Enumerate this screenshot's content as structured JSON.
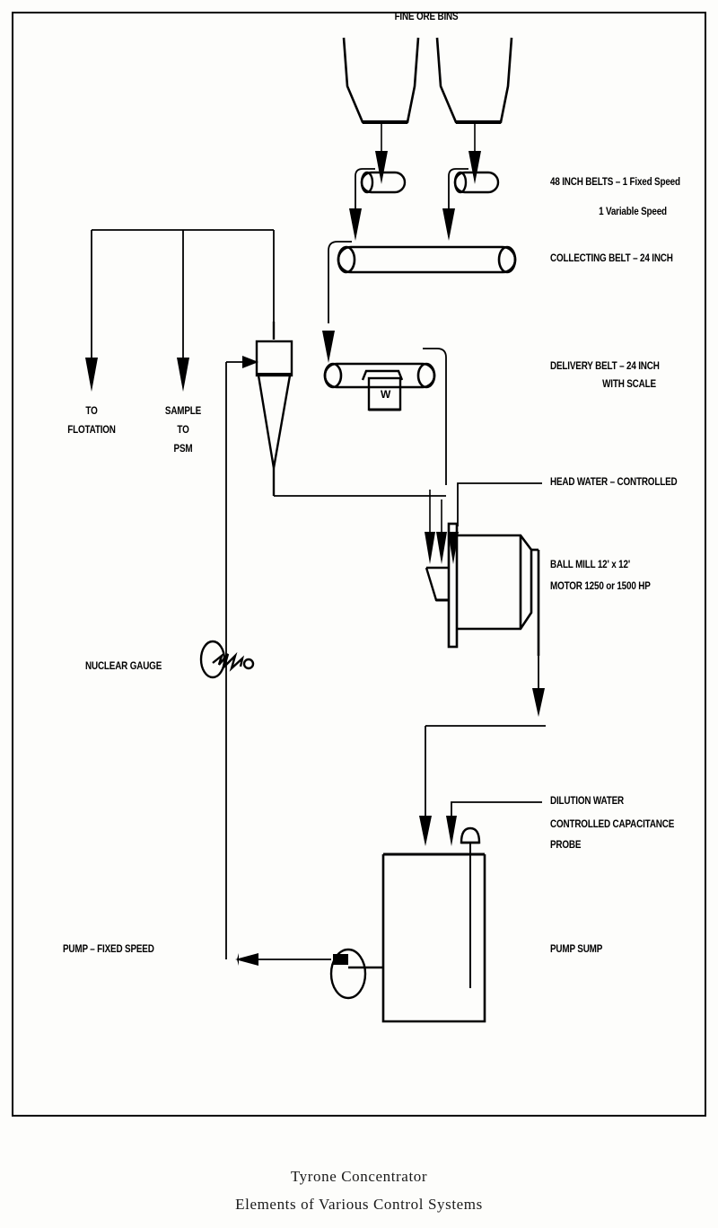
{
  "figure": {
    "title_line_1": "Tyrone Concentrator",
    "title_line_2": "Elements of Various Control Systems"
  },
  "labels": {
    "fine_ore_bins": "FINE ORE BINS",
    "belts_48_line1": "48 INCH BELTS – 1 Fixed Speed",
    "belts_48_line2": "1 Variable Speed",
    "collecting_belt": "COLLECTING BELT – 24 INCH",
    "delivery_belt_line1": "DELIVERY BELT – 24 INCH",
    "delivery_belt_line2": "WITH SCALE",
    "head_water": "HEAD WATER – CONTROLLED",
    "ball_mill_line1": "BALL MILL  12' x 12'",
    "ball_mill_line2": "MOTOR 1250 or 1500 HP",
    "dilution_water": "DILUTION WATER",
    "capacitance_probe_line1": "CONTROLLED CAPACITANCE",
    "capacitance_probe_line2": "PROBE",
    "pump_sump": "PUMP SUMP",
    "pump_fixed_speed": "PUMP – FIXED SPEED",
    "nuclear_gauge": "NUCLEAR GAUGE",
    "to_flotation_line1": "TO",
    "to_flotation_line2": "FLOTATION",
    "sample_to_psm_line1": "SAMPLE",
    "sample_to_psm_line2": "TO",
    "sample_to_psm_line3": "PSM",
    "scale_weight_symbol": "W"
  },
  "colors": {
    "line": "#000000",
    "paper": "#fdfdfb",
    "text": "#000000"
  },
  "chart_data": {
    "type": "flow-diagram",
    "equipment": [
      {
        "name": "fine-ore-bin-left",
        "kind": "bin"
      },
      {
        "name": "fine-ore-bin-right",
        "kind": "bin"
      },
      {
        "name": "feeder-belt-48-left",
        "kind": "belt-roll"
      },
      {
        "name": "feeder-belt-48-right",
        "kind": "belt-roll"
      },
      {
        "name": "collecting-belt-24",
        "kind": "belt-long"
      },
      {
        "name": "delivery-belt-24-with-scale",
        "kind": "belt-with-scale"
      },
      {
        "name": "cyclone",
        "kind": "hydrocyclone"
      },
      {
        "name": "ball-mill",
        "kind": "mill"
      },
      {
        "name": "pump-sump",
        "kind": "tank"
      },
      {
        "name": "sump-pump",
        "kind": "pump"
      },
      {
        "name": "nuclear-gauge",
        "kind": "instrument"
      },
      {
        "name": "capacitance-probe",
        "kind": "instrument"
      }
    ]
  }
}
